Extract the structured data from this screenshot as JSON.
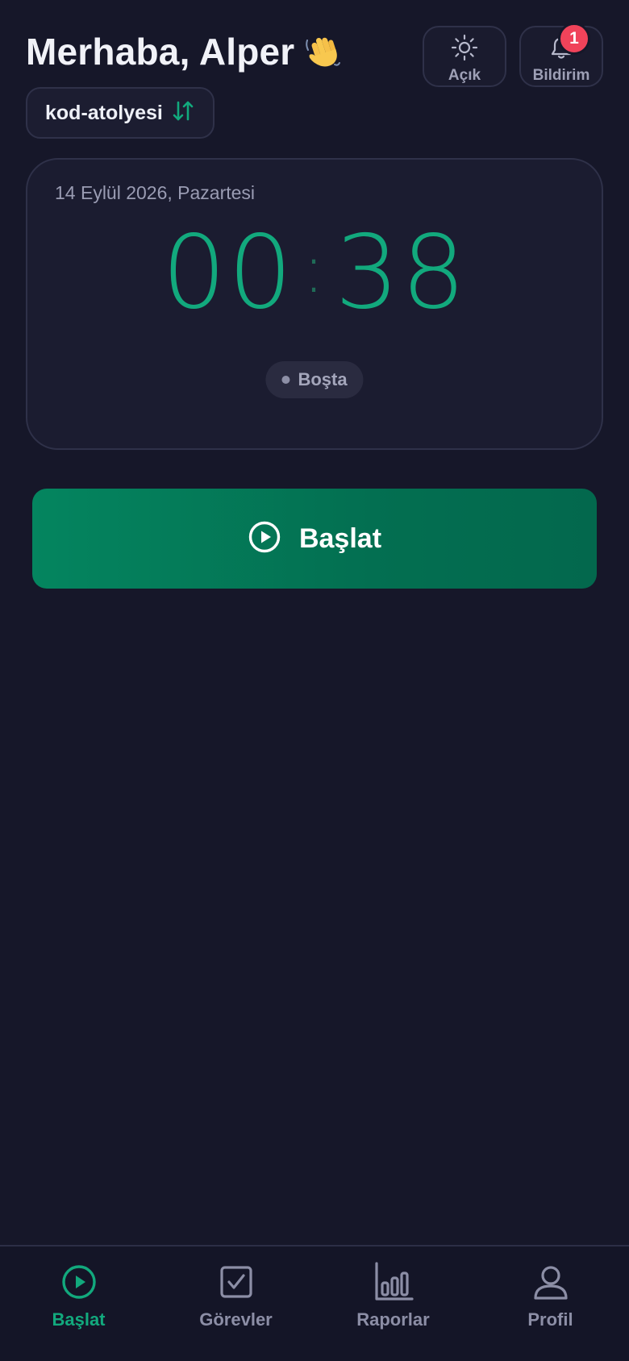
{
  "header": {
    "greeting": "Merhaba, Alper",
    "greeting_icon": "waving-hand-icon",
    "theme_button_label": "Açık",
    "theme_icon": "sun-icon",
    "notifications_label": "Bildirim",
    "notifications_icon": "bell-icon",
    "notification_count": "1"
  },
  "workspace": {
    "name": "kod-atolyesi",
    "icon": "swap-vertical-icon"
  },
  "timer": {
    "date": "14 Eylül 2026, Pazartesi",
    "minutes": "00",
    "separator": ":",
    "seconds": "38",
    "status": "Boşta"
  },
  "start_button": {
    "label": "Başlat",
    "icon": "play-circle-icon"
  },
  "bottom_nav": {
    "items": [
      {
        "label": "Başlat",
        "icon": "play-circle-icon",
        "active": true
      },
      {
        "label": "Görevler",
        "icon": "checkbox-icon",
        "active": false
      },
      {
        "label": "Raporlar",
        "icon": "bar-chart-icon",
        "active": false
      },
      {
        "label": "Profil",
        "icon": "user-icon",
        "active": false
      }
    ]
  },
  "colors": {
    "background": "#161729",
    "accent": "#12a97d",
    "start_button": "#04855f",
    "badge": "#f0435a",
    "muted_text": "#8c8ea6"
  }
}
